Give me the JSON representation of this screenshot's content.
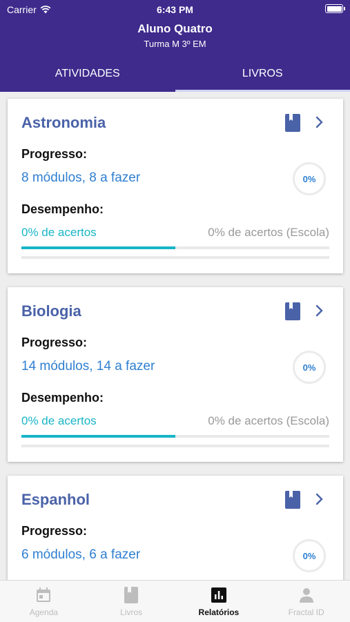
{
  "status_bar": {
    "carrier": "Carrier",
    "time": "6:43 PM"
  },
  "header": {
    "student_name": "Aluno Quatro",
    "class_name": "Turma M 3º EM"
  },
  "tabs": [
    {
      "label": "ATIVIDADES",
      "active": false
    },
    {
      "label": "LIVROS",
      "active": true
    }
  ],
  "labels": {
    "progress": "Progresso:",
    "performance": "Desempenho:"
  },
  "books": [
    {
      "title": "Astronomia",
      "modules": "8 módulos, 8 a fazer",
      "progress_pct": "0%",
      "hits": "0% de acertos",
      "school_hits": "0% de acertos (Escola)",
      "performance_fill_fraction": 0.5
    },
    {
      "title": "Biologia",
      "modules": "14 módulos, 14 a fazer",
      "progress_pct": "0%",
      "hits": "0% de acertos",
      "school_hits": "0% de acertos (Escola)",
      "performance_fill_fraction": 0.5
    },
    {
      "title": "Espanhol",
      "modules": "6 módulos, 6 a fazer",
      "progress_pct": "0%"
    }
  ],
  "bottom_nav": [
    {
      "label": "Agenda",
      "icon": "calendar-icon",
      "active": false
    },
    {
      "label": "Livros",
      "icon": "book-icon",
      "active": false
    },
    {
      "label": "Relatórios",
      "icon": "bar-chart-icon",
      "active": true
    },
    {
      "label": "Fractal ID",
      "icon": "person-icon",
      "active": false
    }
  ],
  "colors": {
    "header": "#3e2b8c",
    "title": "#4a62a8",
    "link": "#2f7fd1",
    "accent": "#18b5c7"
  }
}
